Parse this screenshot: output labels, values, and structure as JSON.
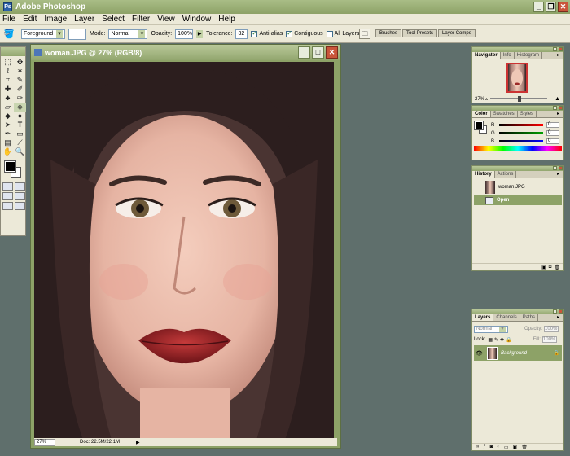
{
  "app": {
    "title": "Adobe Photoshop"
  },
  "menu": [
    "File",
    "Edit",
    "Image",
    "Layer",
    "Select",
    "Filter",
    "View",
    "Window",
    "Help"
  ],
  "options": {
    "fill_source": "Foreground",
    "mode_label": "Mode:",
    "mode_value": "Normal",
    "opacity_label": "Opacity:",
    "opacity_value": "100%",
    "tolerance_label": "Tolerance:",
    "tolerance_value": "32",
    "antialias": "Anti-alias",
    "contiguous": "Contiguous",
    "all_layers": "All Layers"
  },
  "well_tabs": [
    "Brushes",
    "Tool Presets",
    "Layer Comps"
  ],
  "document": {
    "title": "woman.JPG @ 27% (RGB/8)",
    "zoom": "27%",
    "doc_size": "Doc: 22.5M/22.1M"
  },
  "navigator": {
    "tabs": [
      "Navigator",
      "Info",
      "Histogram"
    ],
    "zoom": "27%"
  },
  "color": {
    "tabs": [
      "Color",
      "Swatches",
      "Styles"
    ],
    "channels": [
      {
        "label": "R",
        "value": "0",
        "gradient": "#ff0000"
      },
      {
        "label": "G",
        "value": "0",
        "gradient": "#00a000"
      },
      {
        "label": "B",
        "value": "0",
        "gradient": "#0000ff"
      }
    ]
  },
  "history": {
    "tabs": [
      "History",
      "Actions"
    ],
    "snapshot": "woman.JPG",
    "states": [
      "Open"
    ]
  },
  "layers": {
    "tabs": [
      "Layers",
      "Channels",
      "Paths"
    ],
    "blend_mode": "Normal",
    "opacity_label": "Opacity:",
    "opacity_value": "100%",
    "lock_label": "Lock:",
    "fill_label": "Fill:",
    "fill_value": "100%",
    "items": [
      "Background"
    ]
  },
  "colors": {
    "accent": "#8da267",
    "workspace": "#5f6f6c",
    "chrome": "#ece9d8"
  }
}
